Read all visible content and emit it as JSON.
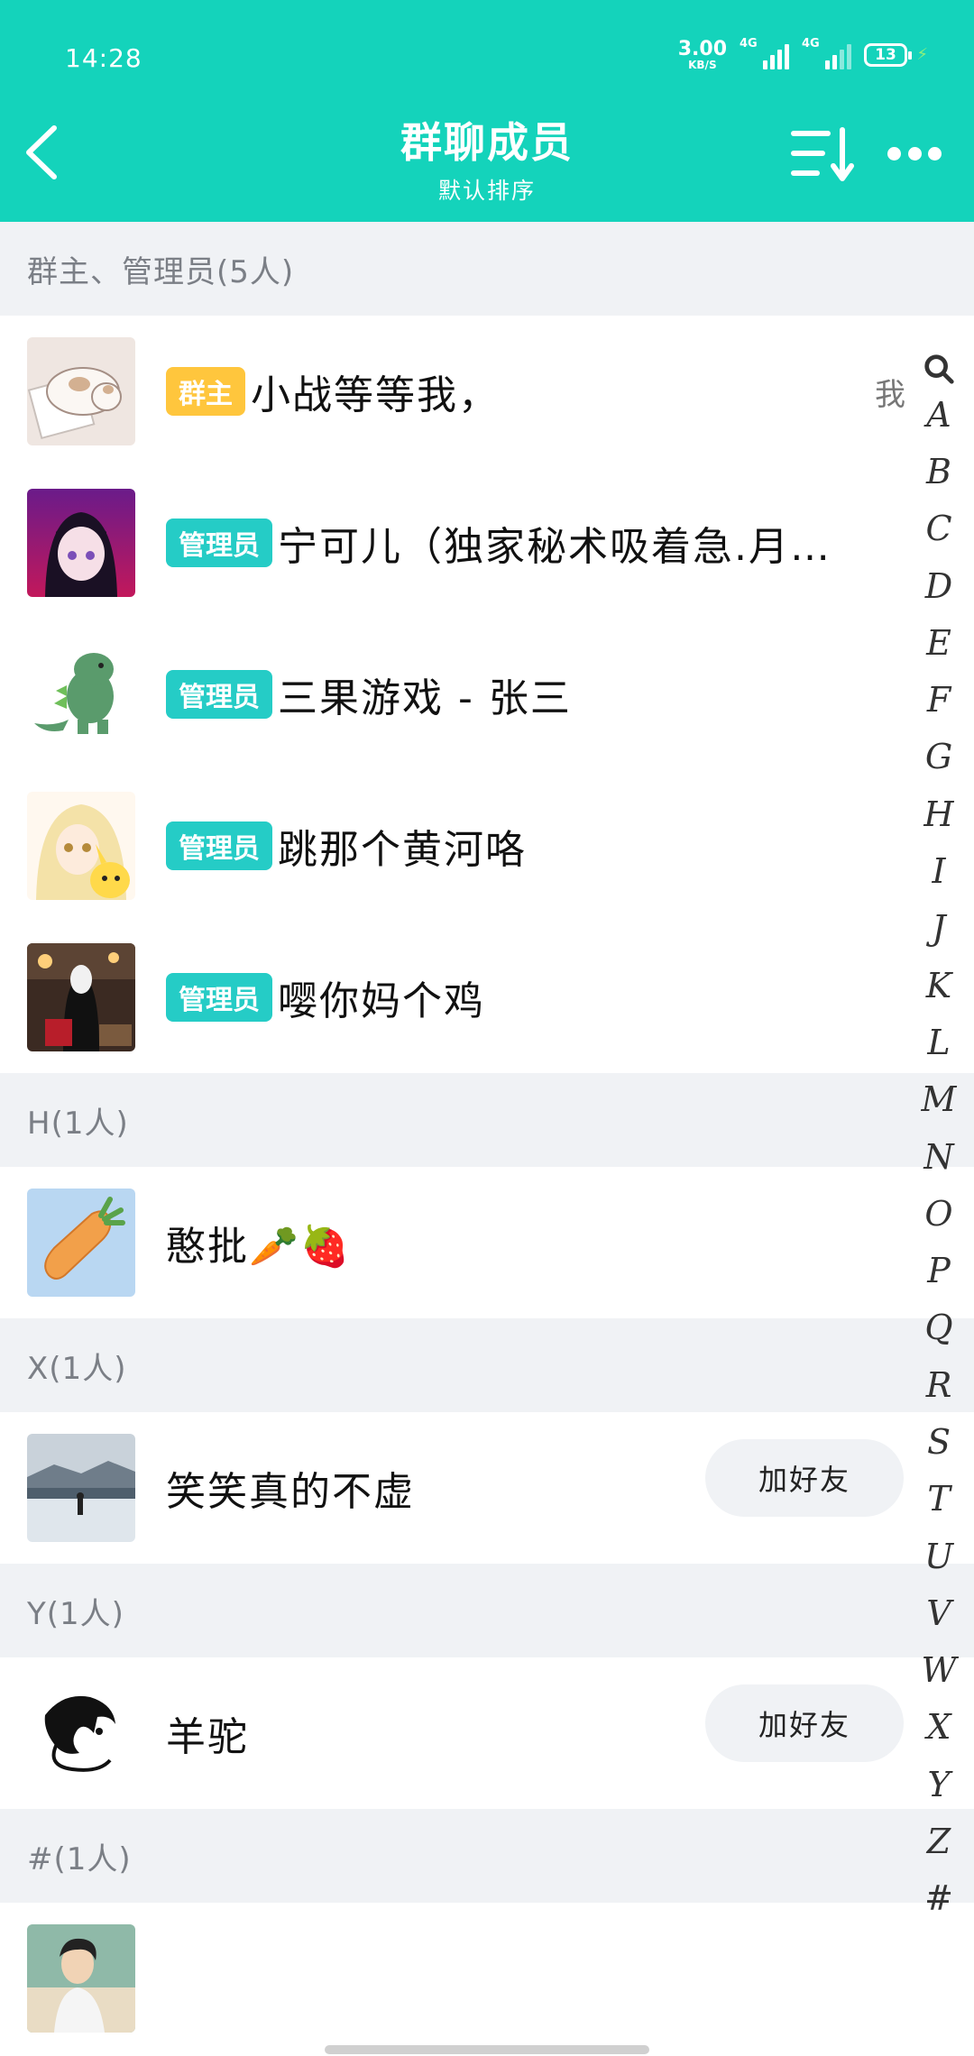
{
  "status_bar": {
    "time": "14:28",
    "net_speed_value": "3.00",
    "net_speed_unit": "KB/S",
    "signal1_label": "4G",
    "signal2_label": "4G",
    "battery_level": "13"
  },
  "header": {
    "title": "群聊成员",
    "subtitle": "默认排序",
    "background_color": "#14d3bb"
  },
  "sections": {
    "admins": "群主、管理员(5人)",
    "h": "H(1人)",
    "x": "X(1人)",
    "y": "Y(1人)",
    "hash": "#(1人)"
  },
  "members": [
    {
      "badge": "群主",
      "name": "小战等等我，",
      "tag": "我"
    },
    {
      "badge": "管理员",
      "name": "宁可儿（独家秘术吸着急.月…"
    },
    {
      "badge": "管理员",
      "name": "三果游戏 - 张三"
    },
    {
      "badge": "管理员",
      "name": "跳那个黄河咯"
    },
    {
      "badge": "管理员",
      "name": "嘤你妈个鸡"
    },
    {
      "name": "憨批🥕🍓"
    },
    {
      "name": "笑笑真的不虚",
      "action": "加好友"
    },
    {
      "name": "羊驼",
      "action": "加好友"
    },
    {
      "name": ""
    }
  ],
  "index": [
    "A",
    "B",
    "C",
    "D",
    "E",
    "F",
    "G",
    "H",
    "I",
    "J",
    "K",
    "L",
    "M",
    "N",
    "O",
    "P",
    "Q",
    "R",
    "S",
    "T",
    "U",
    "V",
    "W",
    "X",
    "Y",
    "Z",
    "#"
  ]
}
